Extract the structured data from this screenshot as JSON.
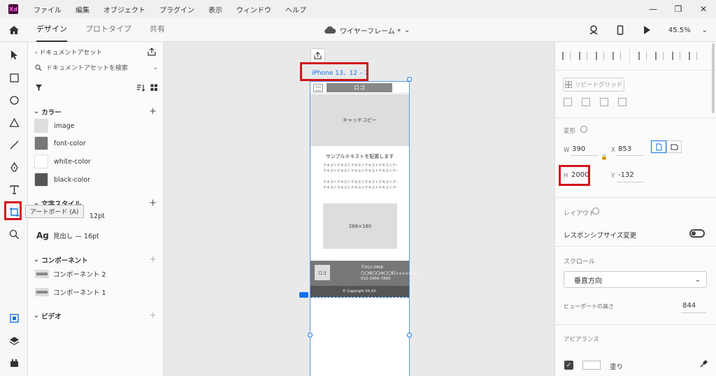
{
  "menubar": {
    "logo": "Xd",
    "items": [
      "ファイル",
      "編集",
      "オブジェクト",
      "プラグイン",
      "表示",
      "ウィンドウ",
      "ヘルプ"
    ],
    "window_controls": [
      "—",
      "❐",
      "✕"
    ]
  },
  "toolbar": {
    "tabs": [
      "デザイン",
      "プロトタイプ",
      "共有"
    ],
    "doc_title": "ワイヤーフレーム *",
    "zoom": "45.5%"
  },
  "tools": {
    "tooltip": "アートボード (A)"
  },
  "assets": {
    "header": "ドキュメントアセット",
    "search_placeholder": "ドキュメントアセットを検索",
    "colors_title": "カラー",
    "colors": [
      {
        "name": "image",
        "color": "#dddddd"
      },
      {
        "name": "font-color",
        "color": "#777777"
      },
      {
        "name": "white-color",
        "color": "#ffffff"
      },
      {
        "name": "black-color",
        "color": "#555555"
      }
    ],
    "text_styles_title": "文字スタイル",
    "text_styles": [
      {
        "ag": "Ag",
        "name": "12pt"
      },
      {
        "ag": "Ag",
        "name": "見出し — 16pt"
      }
    ],
    "components_title": "コンポーネント",
    "components": [
      "コンポーネント 2",
      "コンポーネント 1"
    ],
    "video_title": "ビデオ"
  },
  "canvas": {
    "artboard_label": "iPhone 13、12 – 1",
    "wireframe": {
      "logo": "ロゴ",
      "hero": "キャッチコピー",
      "section_title": "サンプルテキストを配置します",
      "text_lines": [
        "テキストテキストテキストテキストテキストテキスト",
        "テキストテキストテキストテキストテキストテキスト",
        "テキストテキストテキストテキストテキストテキスト",
        "テキストテキストテキストテキストテキストテキスト"
      ],
      "image_size": "288×180",
      "footer_logo": "ロゴ",
      "footer_lines": [
        "〒012-3456",
        "〇〇県〇〇市〇〇町×××××××",
        "012-3456-7890"
      ],
      "copyright": "© Copyright XX,XX."
    }
  },
  "props": {
    "repeat_grid": "リピートグリッド",
    "transform_title": "変形",
    "w_label": "W",
    "w_value": "390",
    "x_label": "X",
    "x_value": "853",
    "h_label": "H",
    "h_value": "2000",
    "y_label": "Y",
    "y_value": "-132",
    "layout_title": "レイアウト",
    "responsive_label": "レスポンシブサイズ変更",
    "scroll_title": "スクロール",
    "scroll_value": "垂直方向",
    "viewport_label": "ビューポートの高さ",
    "viewport_value": "844",
    "appearance_title": "アピアランス",
    "fill_label": "塗り"
  },
  "colors": {
    "highlight": "#d3131a",
    "accent": "#1473e6"
  }
}
